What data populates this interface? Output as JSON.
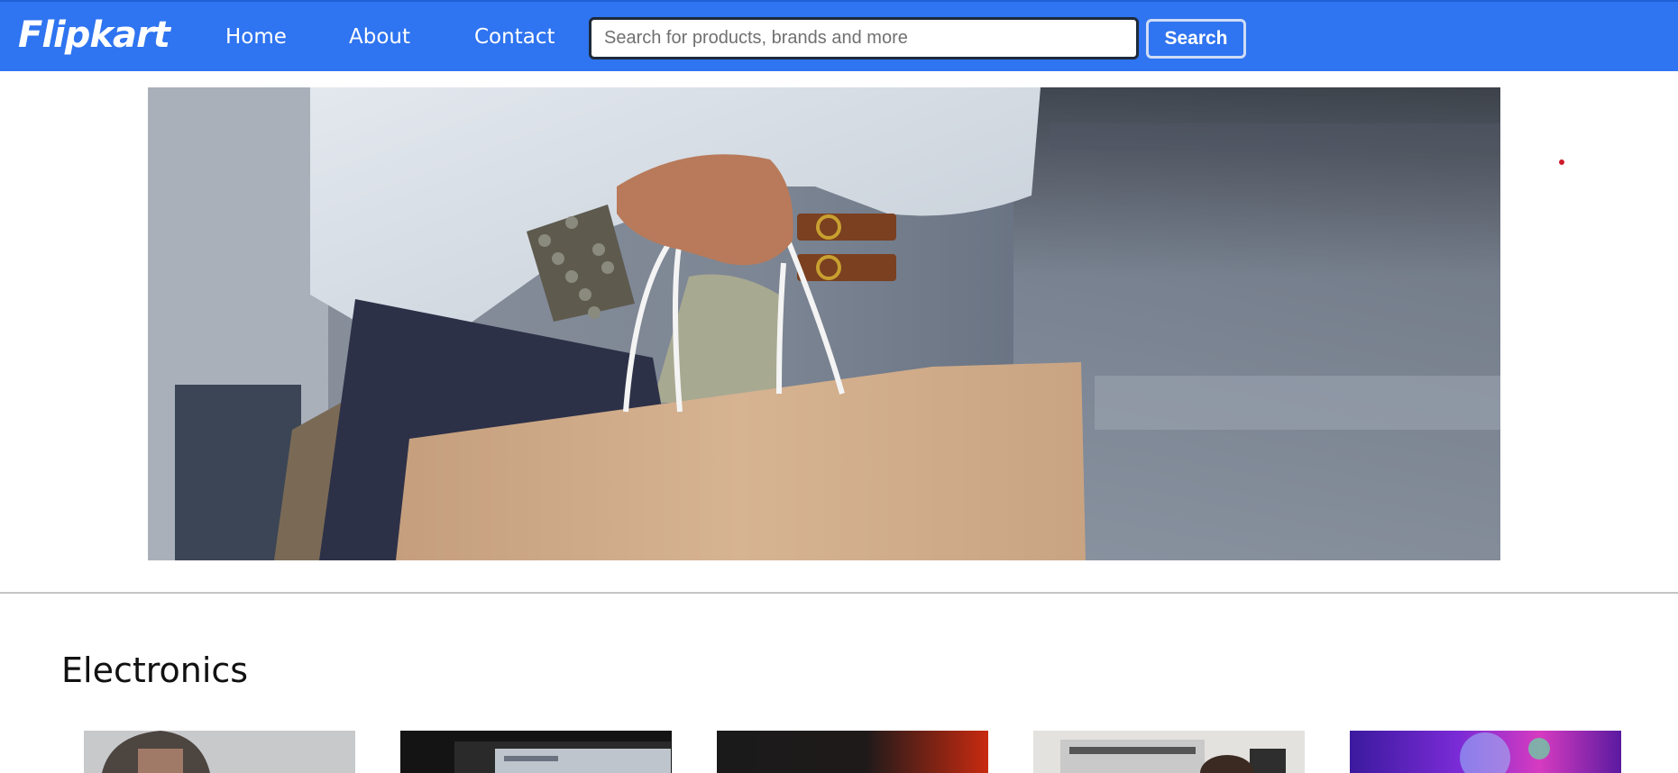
{
  "header": {
    "logo": "Flipkart",
    "nav": [
      {
        "label": "Home"
      },
      {
        "label": "About"
      },
      {
        "label": "Contact"
      }
    ],
    "search": {
      "placeholder": "Search for products, brands and more",
      "value": "",
      "button_label": "Search"
    }
  },
  "hero": {
    "alt": "Woman holding shopping bags"
  },
  "section": {
    "title": "Electronics",
    "cards": [
      {
        "name": "person-at-desk-image"
      },
      {
        "name": "computer-monitor-image"
      },
      {
        "name": "dark-red-gadget-image"
      },
      {
        "name": "studio-setup-image"
      },
      {
        "name": "rgb-lights-image"
      }
    ]
  },
  "colors": {
    "header_bg": "#2f74f0",
    "accent_dot": "#d0192b"
  }
}
